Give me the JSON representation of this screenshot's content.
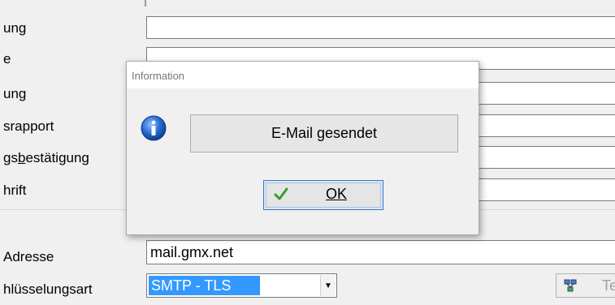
{
  "form": {
    "rows": [
      {
        "label": "ung"
      },
      {
        "label": "e"
      },
      {
        "label": "ung"
      },
      {
        "label": "srapport"
      },
      {
        "label_pre": "gs",
        "label_u": "b",
        "label_post": "estätigung"
      },
      {
        "label": "hrift"
      }
    ]
  },
  "server": {
    "label": "Adresse",
    "value": "mail.gmx.net"
  },
  "encryption": {
    "label": "hlüsselungsart",
    "selected": "SMTP - TLS"
  },
  "test_button": {
    "label": "Te",
    "icon": "network-icon"
  },
  "dialog": {
    "title": "Information",
    "icon": "info-icon",
    "message": "E-Mail gesendet",
    "ok_label": "OK",
    "ok_icon": "checkmark-icon"
  },
  "colors": {
    "selection": "#3399ff",
    "ok_focus_border": "#2c78d0",
    "checkmark": "#3c9a2c",
    "info_blue": "#1f62c9"
  }
}
